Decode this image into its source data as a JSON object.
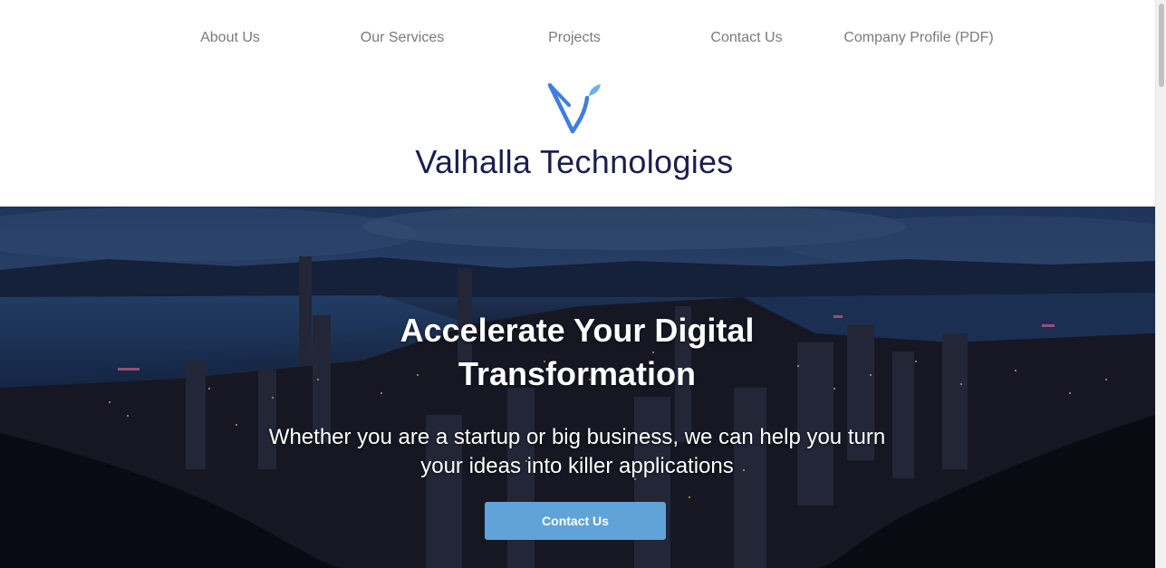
{
  "nav": {
    "items": [
      {
        "label": "About Us"
      },
      {
        "label": "Our Services"
      },
      {
        "label": "Projects"
      },
      {
        "label": "Contact Us"
      },
      {
        "label": "Company Profile (PDF)"
      }
    ]
  },
  "brand": {
    "name": "Valhalla Technologies",
    "logo_icon": "valhalla-v-logo-icon",
    "logo_color": "#3f7de0",
    "logo_drop_color": "#6fb0e6"
  },
  "hero": {
    "title": "Accelerate Your Digital Transformation",
    "subtitle": "Whether you are a startup or big business, we can help you turn your ideas into killer applications",
    "button_label": "Contact Us",
    "button_color": "#5fa3d8",
    "background": "night-city-skyline-image"
  },
  "colors": {
    "nav_text": "#7a7a7a",
    "brand_text": "#1a1f4e"
  }
}
